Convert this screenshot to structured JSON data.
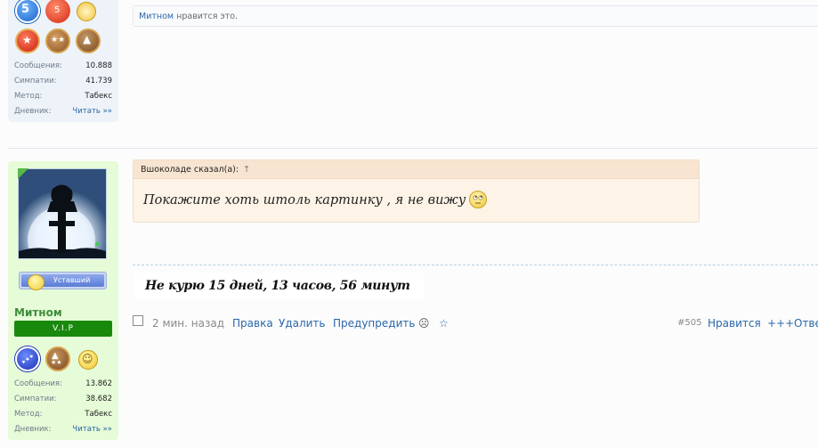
{
  "top_post": {
    "badges_row1": [
      "5",
      "5"
    ],
    "stats": [
      {
        "label": "Сообщения:",
        "value": "10.888"
      },
      {
        "label": "Симпатии:",
        "value": "41.739"
      },
      {
        "label": "Метод:",
        "value": "Табекс"
      },
      {
        "label": "Дневник:",
        "value": "Читать »»"
      }
    ],
    "likes": {
      "user": "Митном",
      "text": " нравится это."
    }
  },
  "user": {
    "status": "Уставший",
    "name": "Митном",
    "rank": "V.I.P",
    "stats": [
      {
        "label": "Сообщения:",
        "value": "13.862"
      },
      {
        "label": "Симпатии:",
        "value": "38.682"
      },
      {
        "label": "Метод:",
        "value": "Табекс"
      },
      {
        "label": "Дневник:",
        "value": "Читать »»"
      }
    ]
  },
  "post": {
    "quote_author": "Вшоколаде сказал(а):",
    "quote_arrow": "↑",
    "quote_text": "Покажите хоть штоль картинку , я не вижу",
    "signature": "Не курю 15 дней, 13 часов, 56 минут"
  },
  "controls": {
    "time": "2 мин. назад",
    "edit": "Правка",
    "delete": "Удалить",
    "warn": "Предупредить",
    "report_icon": "☹",
    "star_icon": "☆",
    "post_number": "#505",
    "like": "Нравится",
    "plus": "+++",
    "reply": "Ответ"
  },
  "colors": {
    "accent": "#2a67a8",
    "user_bg": "#e6fbd7",
    "vip": "#19890e",
    "quote_bg": "#fdf3e7"
  }
}
